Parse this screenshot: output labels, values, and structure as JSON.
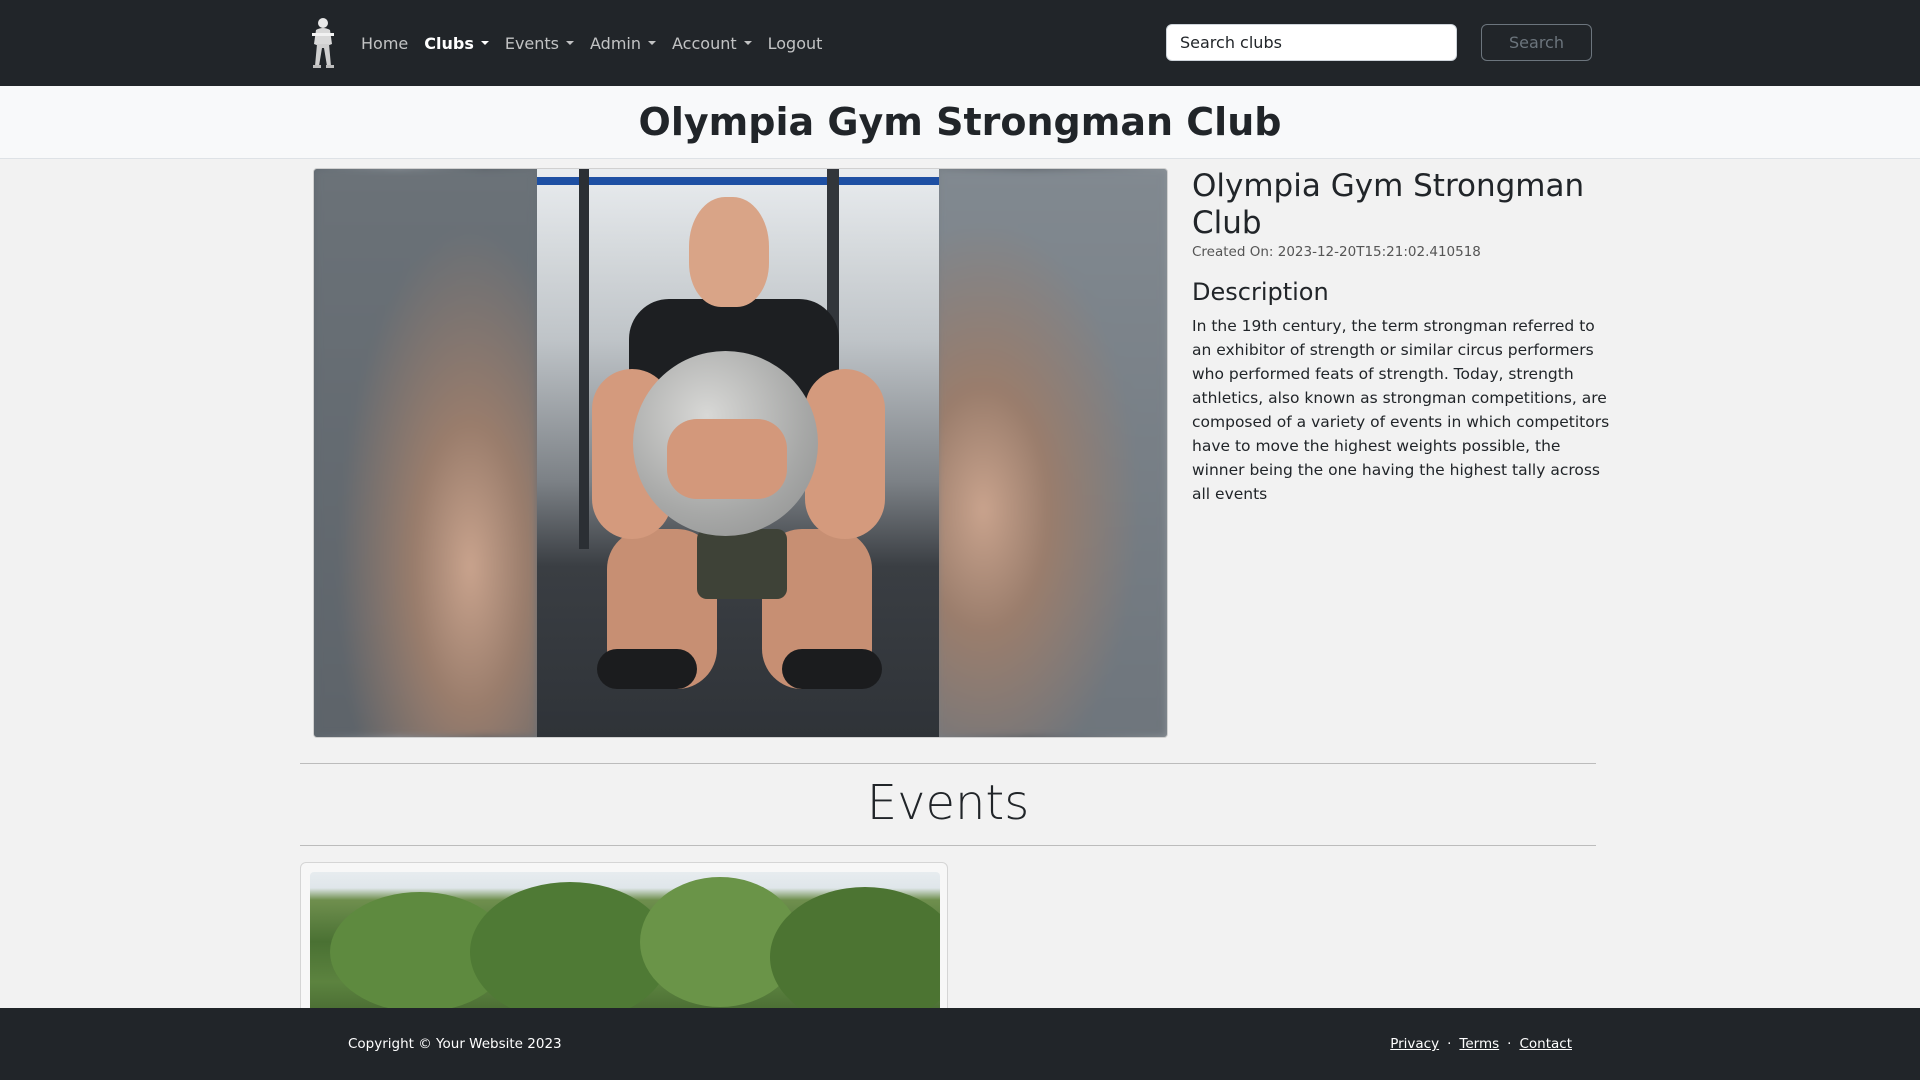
{
  "nav": {
    "brand_icon": "strongman-logo-icon",
    "items": [
      {
        "label": "Home",
        "dropdown": false,
        "active": false
      },
      {
        "label": "Clubs",
        "dropdown": true,
        "active": true
      },
      {
        "label": "Events",
        "dropdown": true,
        "active": false
      },
      {
        "label": "Admin",
        "dropdown": true,
        "active": false
      },
      {
        "label": "Account",
        "dropdown": true,
        "active": false
      },
      {
        "label": "Logout",
        "dropdown": false,
        "active": false
      }
    ],
    "search": {
      "placeholder": "Search clubs",
      "value": "",
      "button_label": "Search"
    }
  },
  "page": {
    "title": "Olympia Gym Strongman Club"
  },
  "club": {
    "name": "Olympia Gym Strongman Club",
    "created": "Created On: 2023-12-20T15:21:02.410518",
    "description_heading": "Description",
    "description": "In the 19th century, the term strongman referred to an exhibitor of strength or similar circus performers who performed feats of strength. Today, strength athletics, also known as strongman competitions, are composed of a variety of events in which competitors have to move the highest weights possible, the winner being the one having the highest tally across all events"
  },
  "events": {
    "heading": "Events"
  },
  "footer": {
    "copyright": "Copyright © Your Website 2023",
    "links": [
      "Privacy",
      "Terms",
      "Contact"
    ],
    "separator": "·"
  },
  "colors": {
    "navbar_bg": "#212529",
    "page_bg": "#f2f2f2",
    "title_band_bg": "#f8f9fa",
    "footer_bg": "#212529"
  }
}
